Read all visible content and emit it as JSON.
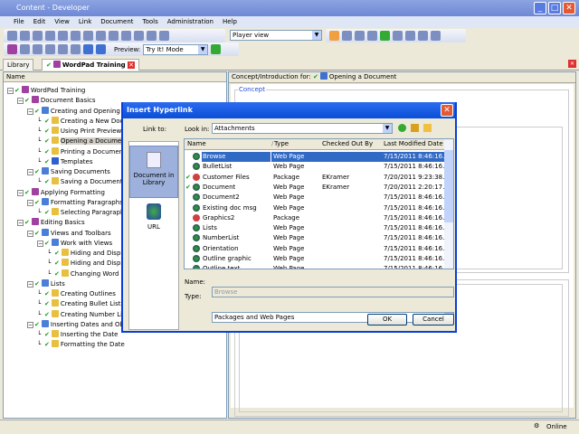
{
  "window": {
    "title": "Content - Developer"
  },
  "menu": [
    "File",
    "Edit",
    "View",
    "Link",
    "Document",
    "Tools",
    "Administration",
    "Help"
  ],
  "toolbar": {
    "view_select": "Player view",
    "preview_label": "Preview:",
    "preview_select": "Try It! Mode"
  },
  "tabs": [
    {
      "label": "Library"
    },
    {
      "label": "WordPad Training"
    }
  ],
  "tree": {
    "header": "Name",
    "items": [
      {
        "label": "WordPad Training",
        "level": 0,
        "kind": "book",
        "exp": true
      },
      {
        "label": "Document Basics",
        "level": 1,
        "kind": "book",
        "exp": true
      },
      {
        "label": "Creating and Opening Do",
        "level": 2,
        "kind": "section",
        "exp": true
      },
      {
        "label": "Creating a New Docum",
        "level": 3,
        "kind": "topic"
      },
      {
        "label": "Using Print Preview",
        "level": 3,
        "kind": "topic"
      },
      {
        "label": "Opening a Document",
        "level": 3,
        "kind": "topic",
        "selected": true
      },
      {
        "label": "Printing a Document",
        "level": 3,
        "kind": "topic"
      },
      {
        "label": "Templates",
        "level": 3,
        "kind": "page"
      },
      {
        "label": "Saving Documents",
        "level": 2,
        "kind": "section",
        "exp": true
      },
      {
        "label": "Saving a Document as",
        "level": 3,
        "kind": "topic"
      },
      {
        "label": "Applying Formatting",
        "level": 1,
        "kind": "book",
        "exp": true
      },
      {
        "label": "Formatting Paragraphs",
        "level": 2,
        "kind": "section",
        "exp": true
      },
      {
        "label": "Selecting Paragraph T",
        "level": 3,
        "kind": "topic"
      },
      {
        "label": "Editing Basics",
        "level": 1,
        "kind": "book",
        "exp": true
      },
      {
        "label": "Views and Toolbars",
        "level": 2,
        "kind": "section",
        "exp": true
      },
      {
        "label": "Work with Views",
        "level": 3,
        "kind": "section",
        "exp": true
      },
      {
        "label": "Hiding and Display",
        "level": 4,
        "kind": "topic"
      },
      {
        "label": "Hiding and Display",
        "level": 4,
        "kind": "topic"
      },
      {
        "label": "Changing Word W",
        "level": 4,
        "kind": "topic"
      },
      {
        "label": "Lists",
        "level": 2,
        "kind": "section",
        "exp": true
      },
      {
        "label": "Creating Outlines",
        "level": 3,
        "kind": "topic"
      },
      {
        "label": "Creating Bullet Lists",
        "level": 3,
        "kind": "topic"
      },
      {
        "label": "Creating Number Lists",
        "level": 3,
        "kind": "topic"
      },
      {
        "label": "Inserting Dates and Objec",
        "level": 2,
        "kind": "section",
        "exp": true
      },
      {
        "label": "Inserting the Date",
        "level": 3,
        "kind": "topic"
      },
      {
        "label": "Formatting the Date",
        "level": 3,
        "kind": "topic"
      }
    ]
  },
  "right": {
    "header_label": "Concept/Introduction for:",
    "header_doc": "Opening a Document",
    "concept_label": "Concept"
  },
  "dialog": {
    "title": "Insert Hyperlink",
    "link_to_label": "Link to:",
    "link_options": [
      "Document in Library",
      "URL"
    ],
    "look_in_label": "Look in:",
    "look_in_value": "Attachments",
    "columns": [
      "Name",
      "Type",
      "Checked Out By",
      "Last Modified Date"
    ],
    "rows": [
      {
        "name": "Browse",
        "type": "Web Page",
        "by": "",
        "date": "7/15/2011 8:46:16...",
        "selected": true
      },
      {
        "name": "BulletList",
        "type": "Web Page",
        "by": "",
        "date": "7/15/2011 8:46:16..."
      },
      {
        "name": "Customer Files",
        "type": "Package",
        "by": "EKramer",
        "date": "7/20/2011 9:23:38...",
        "checked": true
      },
      {
        "name": "Document",
        "type": "Web Page",
        "by": "EKramer",
        "date": "7/20/2011 2:20:17...",
        "checked": true
      },
      {
        "name": "Document2",
        "type": "Web Page",
        "by": "",
        "date": "7/15/2011 8:46:16..."
      },
      {
        "name": "Existing doc msg",
        "type": "Web Page",
        "by": "",
        "date": "7/15/2011 8:46:16..."
      },
      {
        "name": "Graphics2",
        "type": "Package",
        "by": "",
        "date": "7/15/2011 8:46:16..."
      },
      {
        "name": "Lists",
        "type": "Web Page",
        "by": "",
        "date": "7/15/2011 8:46:16..."
      },
      {
        "name": "NumberList",
        "type": "Web Page",
        "by": "",
        "date": "7/15/2011 8:46:16..."
      },
      {
        "name": "Orientation",
        "type": "Web Page",
        "by": "",
        "date": "7/15/2011 8:46:16..."
      },
      {
        "name": "Outline graphic",
        "type": "Web Page",
        "by": "",
        "date": "7/15/2011 8:46:16..."
      },
      {
        "name": "Outline text",
        "type": "Web Page",
        "by": "",
        "date": "7/15/2011 8:46:16..."
      }
    ],
    "name_label": "Name:",
    "name_value": "Browse",
    "type_label": "Type:",
    "type_value": "Packages and Web Pages",
    "ok": "OK",
    "cancel": "Cancel"
  },
  "status": {
    "text": "Online"
  },
  "colors": {
    "title": "#0a4fd8",
    "selection": "#316ac5",
    "check": "#1c9d1c"
  }
}
